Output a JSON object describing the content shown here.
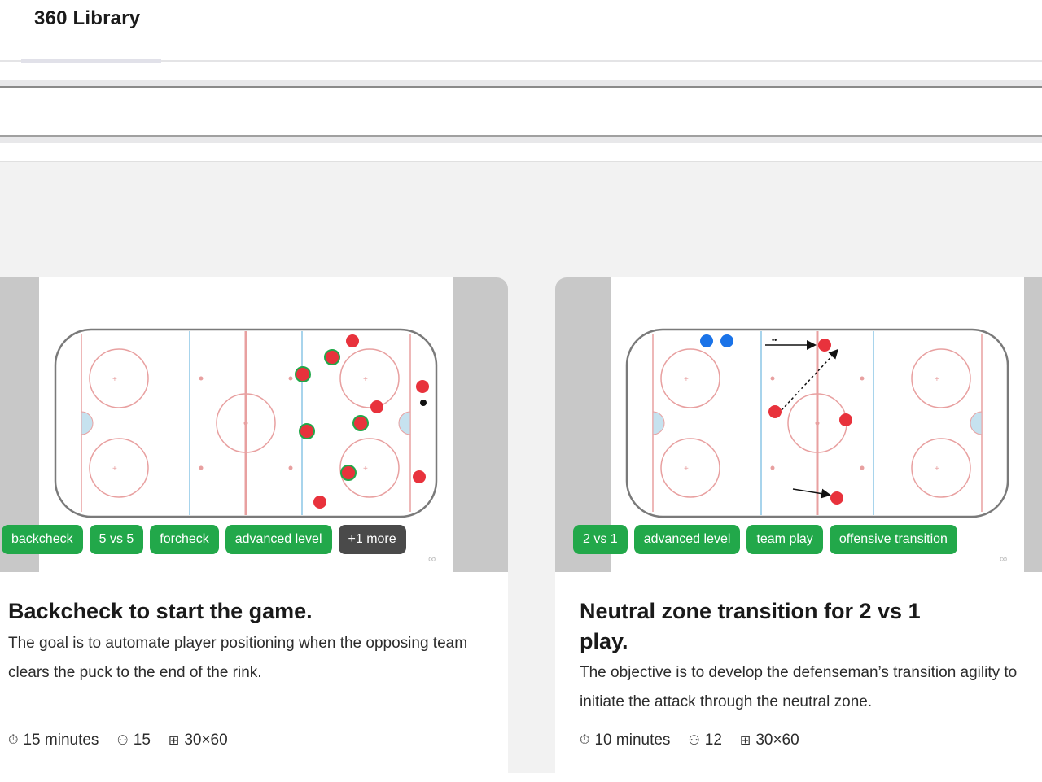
{
  "tabs": [
    {
      "label": "360 Library"
    }
  ],
  "cards": [
    {
      "tags": [
        "backcheck",
        "5 vs 5",
        "forcheck",
        "advanced level"
      ],
      "more": "+1 more",
      "title": "Backcheck to start the game.",
      "description": "The goal is to automate player positioning when the opposing team clears the puck to the end of the rink.",
      "duration": "15 minutes",
      "players": "15",
      "size": "30×60"
    },
    {
      "tags": [
        "2 vs 1",
        "advanced level",
        "team play",
        "offensive transition"
      ],
      "title": "Neutral zone transition for 2 vs 1 play.",
      "description": "The objective is to develop the defenseman’s transition agility to initiate the attack through the neutral zone.",
      "duration": "10 minutes",
      "players": "12",
      "size": "30×60"
    }
  ],
  "icons": {
    "duration": "stopwatch-icon",
    "players": "players-icon",
    "size": "grid-size-icon"
  },
  "colors": {
    "tag": "#22a84a",
    "tag_more": "#4a4a4a",
    "player_red": "#e8323c",
    "player_blue": "#1a73e8"
  }
}
